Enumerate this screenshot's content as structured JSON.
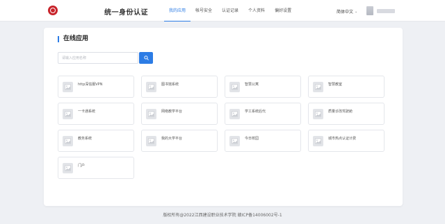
{
  "header": {
    "title": "统一身份认证",
    "nav": [
      {
        "label": "我的应用",
        "active": true
      },
      {
        "label": "帐号安全",
        "active": false
      },
      {
        "label": "认证记录",
        "active": false
      },
      {
        "label": "个人资料",
        "active": false
      },
      {
        "label": "偏好设置",
        "active": false
      }
    ],
    "language": "简体中文"
  },
  "main": {
    "section_title": "在线应用",
    "search": {
      "placeholder": "请输入应用名称"
    },
    "apps": [
      {
        "label": "http深信服VPN"
      },
      {
        "label": "图书馆系统"
      },
      {
        "label": "智慧公寓"
      },
      {
        "label": "智慧教室"
      },
      {
        "label": "一卡通系统"
      },
      {
        "label": "网络教学平台"
      },
      {
        "label": "学工系统后代"
      },
      {
        "label": "质量诊改驾驶舱"
      },
      {
        "label": "教务系统"
      },
      {
        "label": "我的大学平台"
      },
      {
        "label": "今日校园"
      },
      {
        "label": "城市热点认证计费"
      },
      {
        "label": "门户"
      }
    ]
  },
  "footer": {
    "text": "版权所有@2022江西建设职业技术学院 赣ICP备14006002号-1"
  },
  "colors": {
    "accent": "#2c7ce5",
    "logo": "#c8242b"
  }
}
